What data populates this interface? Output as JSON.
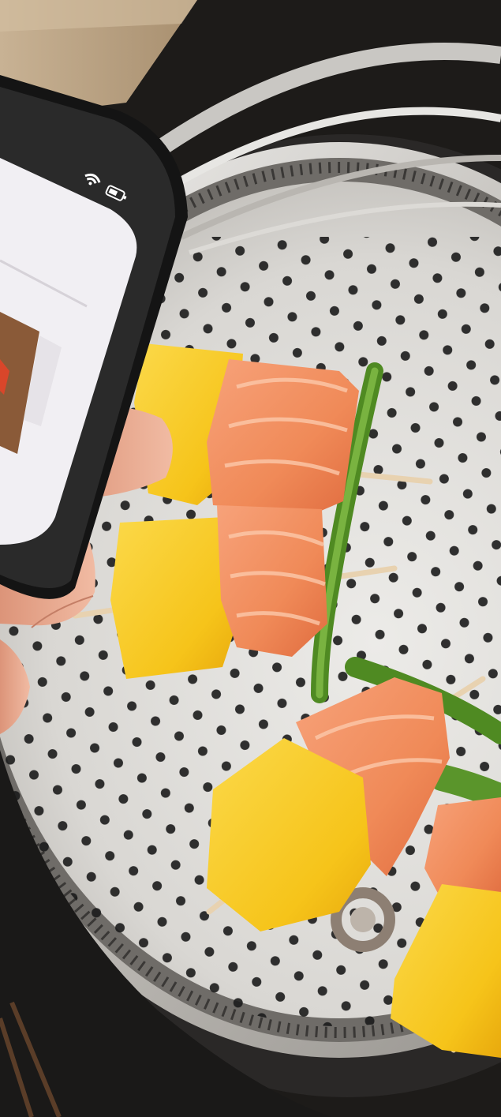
{
  "scene": {
    "description_free": true,
    "phone": {
      "status_icons": [
        "wifi-icon",
        "battery-icon"
      ]
    },
    "colors": {
      "steamer_metal": "#d8d6d2",
      "wood_counter": "#b9a283",
      "salmon": "#f08c5c",
      "mango": "#f7c81e",
      "green_bean": "#5f9a2c",
      "phone_frame": "#141414",
      "phone_screen": "#f1eff3",
      "skin": "#e9a98f"
    }
  }
}
